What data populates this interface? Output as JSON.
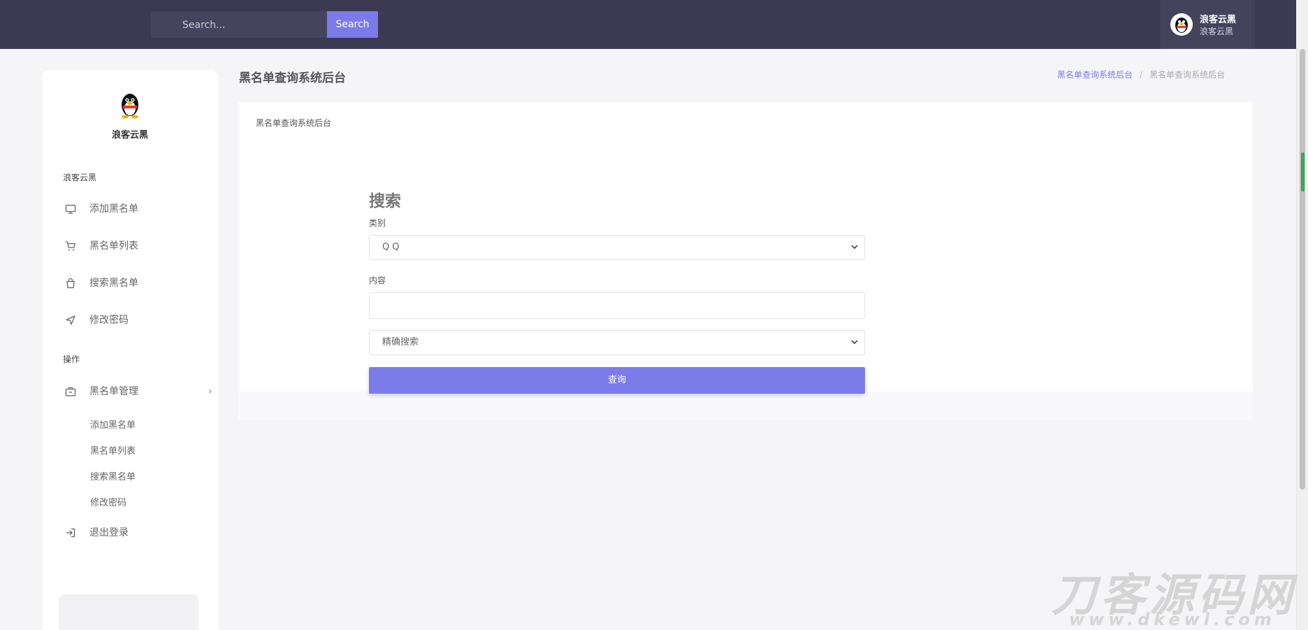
{
  "topbar": {
    "search_placeholder": "Search...",
    "search_button": "Search",
    "user_name": "浪客云黑",
    "user_subtitle": "浪客云黑"
  },
  "sidebar": {
    "brand": "浪客云黑",
    "section_main": "浪客云黑",
    "items": [
      {
        "label": "添加黑名单",
        "icon": "monitor-icon"
      },
      {
        "label": "黑名单列表",
        "icon": "cart-icon"
      },
      {
        "label": "搜索黑名单",
        "icon": "bag-icon"
      },
      {
        "label": "修改密码",
        "icon": "navigation-icon"
      }
    ],
    "section_ops": "操作",
    "manage": {
      "label": "黑名单管理",
      "icon": "briefcase-icon",
      "chevron": "›"
    },
    "sub_items": [
      "添加黑名单",
      "黑名单列表",
      "搜索黑名单",
      "修改密码"
    ],
    "logout": {
      "label": "退出登录",
      "icon": "logout-icon"
    }
  },
  "header": {
    "title": "黑名单查询系统后台",
    "breadcrumb_link": "黑名单查询系统后台",
    "breadcrumb_sep": "/",
    "breadcrumb_current": "黑名单查询系统后台"
  },
  "card": {
    "title": "黑名单查询系统后台"
  },
  "form": {
    "heading": "搜索",
    "category_label": "类别",
    "category_value": "QQ",
    "content_label": "内容",
    "content_value": "",
    "mode_value": "精确搜索",
    "submit": "查询"
  },
  "watermark": {
    "line1": "刀客源码网",
    "line2": "www.dkewl.com"
  },
  "colors": {
    "topbar": "#3b3a52",
    "accent": "#7b7bea"
  }
}
